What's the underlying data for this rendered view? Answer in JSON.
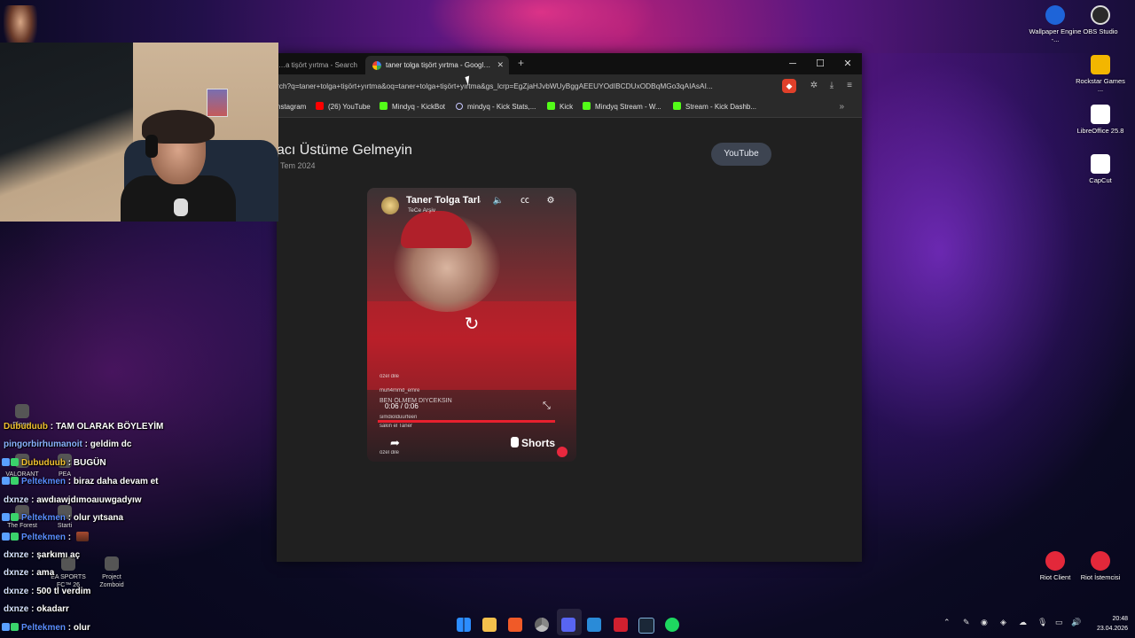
{
  "browser": {
    "tabs": [
      {
        "label": "…a tişört yırtma - Search",
        "active": false
      },
      {
        "label": "taner tolga tişört yırtma - Googl…",
        "active": true
      }
    ],
    "new_tab": "+",
    "window_controls": {
      "minimize": "─",
      "maximize": "☐",
      "close": "✕"
    },
    "url": "rch?q=taner+tolga+tişört+yırtma&oq=taner+tolga+tişört+yırtma&gs_lcrp=EgZjaHJvbWUyBggAEEUYOdIBCDUxODBqMGo3qAIAsAI...",
    "bookmarks": [
      {
        "label": "nstagram",
        "icon": "instagram-icon"
      },
      {
        "label": "(26) YouTube",
        "icon": "youtube-icon"
      },
      {
        "label": "Mindyq - KickBot",
        "icon": "kick-icon"
      },
      {
        "label": "mindyq - Kick Stats,...",
        "icon": "kickstats-icon"
      },
      {
        "label": "Kick",
        "icon": "kick-icon"
      },
      {
        "label": "Mindyq Stream - W...",
        "icon": "kick-icon"
      },
      {
        "label": "Stream - Kick Dashb...",
        "icon": "kick-icon"
      }
    ],
    "bookmarks_more": "»"
  },
  "page": {
    "video_title": "acı Üstüme Gelmeyin",
    "video_date": "Tem 2024",
    "youtube_button": "YouTube"
  },
  "short": {
    "channel_title": "Taner Tolga Tarla",
    "channel_sub": "TeCe Arşiv",
    "comments": [
      "özel dile",
      "muh4mmd_emre",
      "BEN ÖLMEM DIYCEKSIN",
      "simdiolduurfeen",
      "sakin el Taner",
      "özel dile"
    ],
    "time": "0:06 / 0:06",
    "progress": 1.0,
    "shorts_label": "Shorts"
  },
  "chat": [
    {
      "user": "Dubuduub",
      "msg": "TAM OLARAK BÖYLEYİM",
      "color": "#f0c030",
      "badges": 0
    },
    {
      "user": "pingorbirhumanoit",
      "msg": "geldim dc",
      "color": "#6aa0ff",
      "badges": 0
    },
    {
      "user": "Dubuduub",
      "msg": "BUGÜN",
      "color": "#f0c030",
      "badges": 2
    },
    {
      "user": "Peltekmen",
      "msg": "biraz daha devam et",
      "color": "#6aa0ff",
      "badges": 2
    },
    {
      "user": "dxnze",
      "msg": "awdıawjdımoaıuwgadyıw",
      "color": "#cfe0ff",
      "badges": 0
    },
    {
      "user": "Peltekmen",
      "msg": "olur yıtsana",
      "color": "#6aa0ff",
      "badges": 2
    },
    {
      "user": "Peltekmen",
      "msg": "",
      "color": "#6aa0ff",
      "badges": 2,
      "emote": true
    },
    {
      "user": "dxnze",
      "msg": "şarkımı aç",
      "color": "#cfe0ff",
      "badges": 0
    },
    {
      "user": "dxnze",
      "msg": "ama",
      "color": "#cfe0ff",
      "badges": 0
    },
    {
      "user": "dxnze",
      "msg": "500 tl verdim",
      "color": "#cfe0ff",
      "badges": 0
    },
    {
      "user": "dxnze",
      "msg": "okadarr",
      "color": "#cfe0ff",
      "badges": 0
    },
    {
      "user": "Peltekmen",
      "msg": "olur",
      "color": "#6aa0ff",
      "badges": 2
    }
  ],
  "desktop_icons_right": [
    {
      "label": "Wallpaper Engine -...",
      "icon": "wallpaper-engine-icon"
    },
    {
      "label": "OBS Studio",
      "icon": "obs-icon"
    },
    {
      "label": "Rockstar Games ...",
      "icon": "rockstar-icon"
    },
    {
      "label": "LibreOffice 25.8",
      "icon": "libreoffice-icon"
    },
    {
      "label": "CapCut",
      "icon": "capcut-icon"
    },
    {
      "label": "Riot Client",
      "icon": "riot-client-icon"
    },
    {
      "label": "Riot İstemcisi",
      "icon": "riot-istemcisi-icon"
    }
  ],
  "desktop_icons_left": [
    {
      "label": "Flipper",
      "icon": "flipper-icon"
    },
    {
      "label": "VALORANT",
      "icon": "valorant-icon"
    },
    {
      "label": "PEA",
      "icon": "pea-icon"
    },
    {
      "label": "The Forest",
      "icon": "forest-icon"
    },
    {
      "label": "Starti",
      "icon": "starti-icon"
    },
    {
      "label": "EA SPORTS FC™ 26",
      "icon": "fc26-icon"
    },
    {
      "label": "Project Zomboid",
      "icon": "zomboid-icon"
    }
  ],
  "taskbar": {
    "apps": [
      "windows-start-icon",
      "file-explorer-icon",
      "brave-icon",
      "chrome-icon",
      "discord-icon",
      "vscode-icon",
      "riot-icon",
      "steam-icon",
      "spotify-icon"
    ],
    "time": "20:48",
    "date": "23.04.2026"
  }
}
